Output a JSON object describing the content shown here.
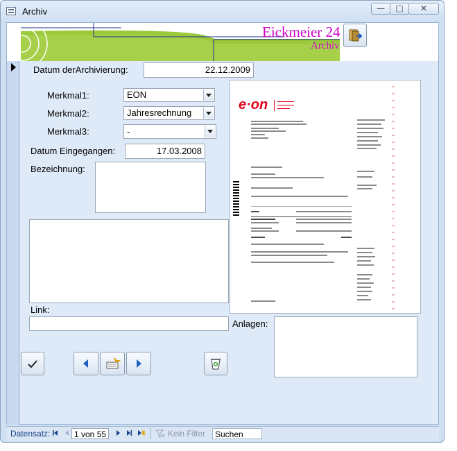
{
  "window": {
    "title": "Archiv"
  },
  "header": {
    "company": "Eickmeier 24",
    "subtitle": "Archiv",
    "accent_color": "#cc00cc"
  },
  "fields": {
    "datum_archivierung_label": "Datum derArchivierung:",
    "datum_archivierung_value": "22.12.2009",
    "merkmal1_label": "Merkmal1:",
    "merkmal1_value": "EON",
    "merkmal2_label": "Merkmal2:",
    "merkmal2_value": "Jahresrechnung",
    "merkmal3_label": "Merkmal3:",
    "merkmal3_value": "-",
    "datum_eingegangen_label": "Datum Eingegangen:",
    "datum_eingegangen_value": "17.03.2008",
    "bezeichnung_label": "Bezeichnung:",
    "bezeichnung_value": "",
    "notes_value": "",
    "link_label": "Link:",
    "link_value": "",
    "anlagen_label": "Anlagen:"
  },
  "document": {
    "logo_text": "e·on",
    "brand_color": "#e2001a"
  },
  "navigation": {
    "record_label": "Datensatz:",
    "record_position": "1 von 55",
    "filter_label": "Kein Filter",
    "search_label": "Suchen"
  }
}
